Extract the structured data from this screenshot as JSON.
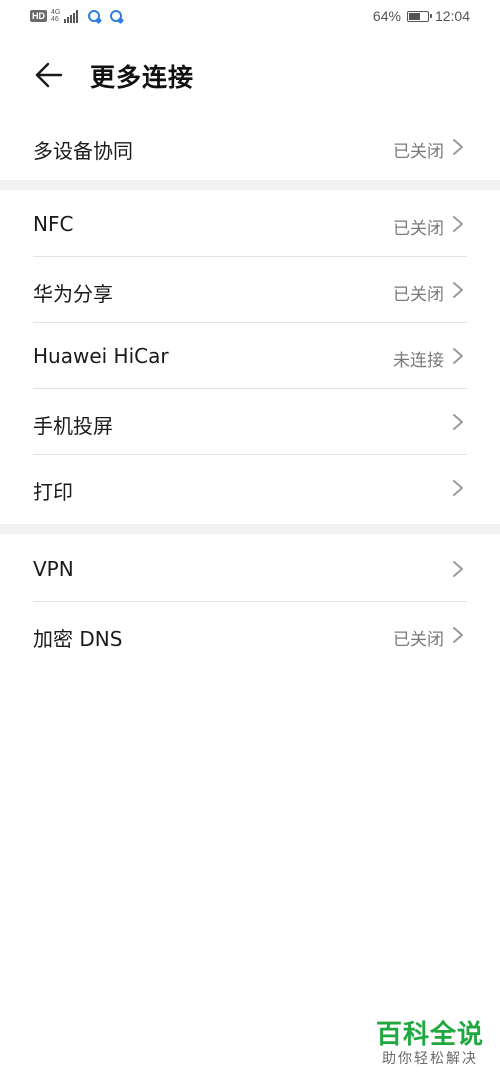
{
  "status_bar": {
    "hd": "HD",
    "network_type": "4G",
    "network_sub": "46",
    "battery_percent": "64%",
    "battery_level": 0.64,
    "time": "12:04",
    "app_icons": [
      "notification-app-icon",
      "notification-app-icon"
    ]
  },
  "header": {
    "back_icon": "arrow-left-icon",
    "title": "更多连接"
  },
  "groups": [
    {
      "items": [
        {
          "label": "多设备协同",
          "value": "已关闭"
        }
      ]
    },
    {
      "items": [
        {
          "label": "NFC",
          "value": "已关闭"
        },
        {
          "label": "华为分享",
          "value": "已关闭"
        },
        {
          "label": "Huawei HiCar",
          "value": "未连接"
        },
        {
          "label": "手机投屏",
          "value": ""
        },
        {
          "label": "打印",
          "value": ""
        }
      ]
    },
    {
      "items": [
        {
          "label": "VPN",
          "value": ""
        },
        {
          "label": "加密 DNS",
          "value": "已关闭"
        }
      ]
    }
  ],
  "chevron_icon": "chevron-right-icon",
  "watermark": {
    "title": "百科全说",
    "subtitle": "助你轻松解决"
  },
  "colors": {
    "background": "#ffffff",
    "group_gap": "#f2f2f2",
    "label": "#1a1a1a",
    "value": "#7a7a7a",
    "watermark_green": "#1fa83f"
  }
}
